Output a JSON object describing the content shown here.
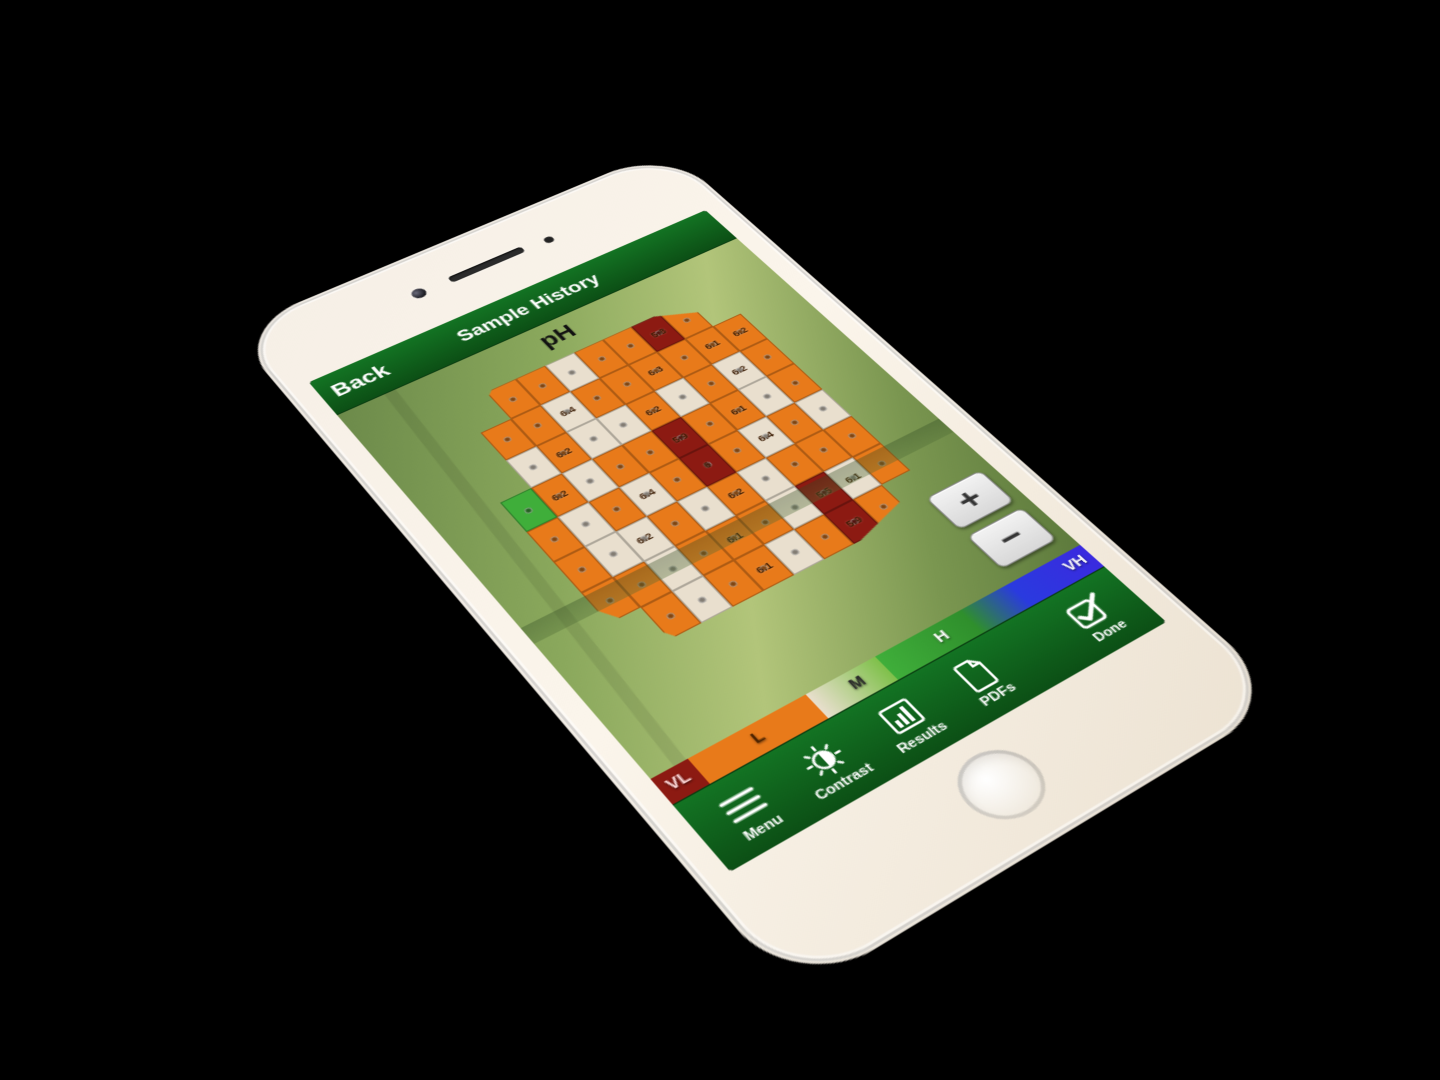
{
  "topbar": {
    "back_label": "Back",
    "title": "Sample History"
  },
  "map": {
    "measure_label": "pH"
  },
  "zoom": {
    "in_glyph": "+",
    "out_glyph": "−"
  },
  "legend": {
    "labels": {
      "VL": "VL",
      "L": "L",
      "M": "M",
      "H": "H",
      "VH": "VH"
    },
    "colors": {
      "VL": "#8c1a12",
      "L": "#e87a1a",
      "M": "#e9dfce",
      "H": "#3fae3a",
      "VH": "#3a3ae0"
    }
  },
  "toolbar": {
    "menu": "Menu",
    "contrast": "Contrast",
    "results": "Results",
    "pdfs": "PDFs",
    "done": "Done"
  },
  "field": {
    "unit": "pH",
    "rows": 8,
    "cols": 10,
    "cells": [
      [
        "",
        "",
        "L",
        "L",
        "M",
        "L",
        "L",
        "VL",
        "L",
        ""
      ],
      [
        "",
        "L",
        "L",
        "M",
        "L",
        "L",
        "L",
        "L",
        "L",
        "L"
      ],
      [
        "",
        "M",
        "L",
        "M",
        "M",
        "L",
        "M",
        "L",
        "M",
        "L"
      ],
      [
        "H",
        "L",
        "M",
        "L",
        "L",
        "VL",
        "L",
        "L",
        "M",
        "L"
      ],
      [
        "L",
        "M",
        "L",
        "M",
        "L",
        "VL",
        "L",
        "M",
        "L",
        "M"
      ],
      [
        "L",
        "M",
        "M",
        "L",
        "M",
        "L",
        "M",
        "L",
        "L",
        "L"
      ],
      [
        "L",
        "L",
        "M",
        "L",
        "L",
        "L",
        "M",
        "VL",
        "M",
        "L"
      ],
      [
        "",
        "L",
        "M",
        "L",
        "L",
        "M",
        "L",
        "VL",
        "L",
        ""
      ]
    ],
    "labeled_values": [
      {
        "r": 0,
        "c": 7,
        "v": "5.8"
      },
      {
        "r": 3,
        "c": 5,
        "v": "5.9"
      },
      {
        "r": 4,
        "c": 5,
        "v": "6"
      },
      {
        "r": 6,
        "c": 7,
        "v": "5.5"
      },
      {
        "r": 7,
        "c": 7,
        "v": "5.9"
      },
      {
        "r": 1,
        "c": 3,
        "v": "6.4"
      },
      {
        "r": 1,
        "c": 6,
        "v": "6.3"
      },
      {
        "r": 2,
        "c": 2,
        "v": "6.2"
      },
      {
        "r": 2,
        "c": 5,
        "v": "6.2"
      },
      {
        "r": 2,
        "c": 8,
        "v": "6.2"
      },
      {
        "r": 3,
        "c": 1,
        "v": "6.2"
      },
      {
        "r": 3,
        "c": 7,
        "v": "6.1"
      },
      {
        "r": 4,
        "c": 3,
        "v": "6.4"
      },
      {
        "r": 4,
        "c": 7,
        "v": "6.4"
      },
      {
        "r": 5,
        "c": 2,
        "v": "6.2"
      },
      {
        "r": 5,
        "c": 5,
        "v": "6.2"
      },
      {
        "r": 6,
        "c": 4,
        "v": "6.1"
      },
      {
        "r": 6,
        "c": 8,
        "v": "6.1"
      },
      {
        "r": 7,
        "c": 4,
        "v": "6.1"
      },
      {
        "r": 1,
        "c": 8,
        "v": "6.1"
      },
      {
        "r": 1,
        "c": 9,
        "v": "6.2"
      }
    ]
  }
}
